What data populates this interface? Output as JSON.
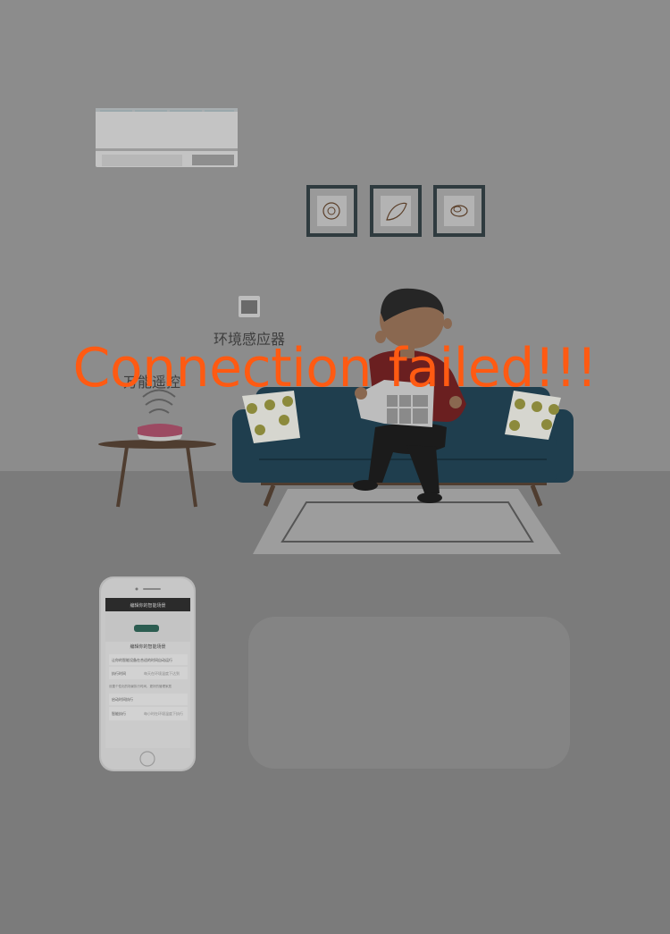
{
  "scene": {
    "sensor_label": "环境感应器",
    "remote_label": "万能遥控"
  },
  "error_message": "Connection failed!!!",
  "phone": {
    "nav_title": "编辑你的智能场景",
    "heading": "编辑你的智能场景",
    "rows": [
      {
        "label": "让你的智能设备在合适的时间自动运行",
        "value": ""
      },
      {
        "label": "执行时间",
        "value": "每天在环境温度下达到"
      },
      {
        "label": "启动时间执行",
        "value": ""
      },
      {
        "label": "智能执行",
        "value": "每小时在环境温度下执行"
      }
    ],
    "note": "设置个性化的场景执行时间，更好的管理家居"
  },
  "colors": {
    "overlay": "#8c8c8c",
    "floor": "#7b7b7b",
    "error": "#ff5a12",
    "sofa": "#1f3e4e",
    "pillow": "#d6d6cf",
    "pillow_dot": "#8c8a3c",
    "shirt": "#6a1f20",
    "table": "#4f3d30",
    "remote_top": "#9c4a62"
  }
}
